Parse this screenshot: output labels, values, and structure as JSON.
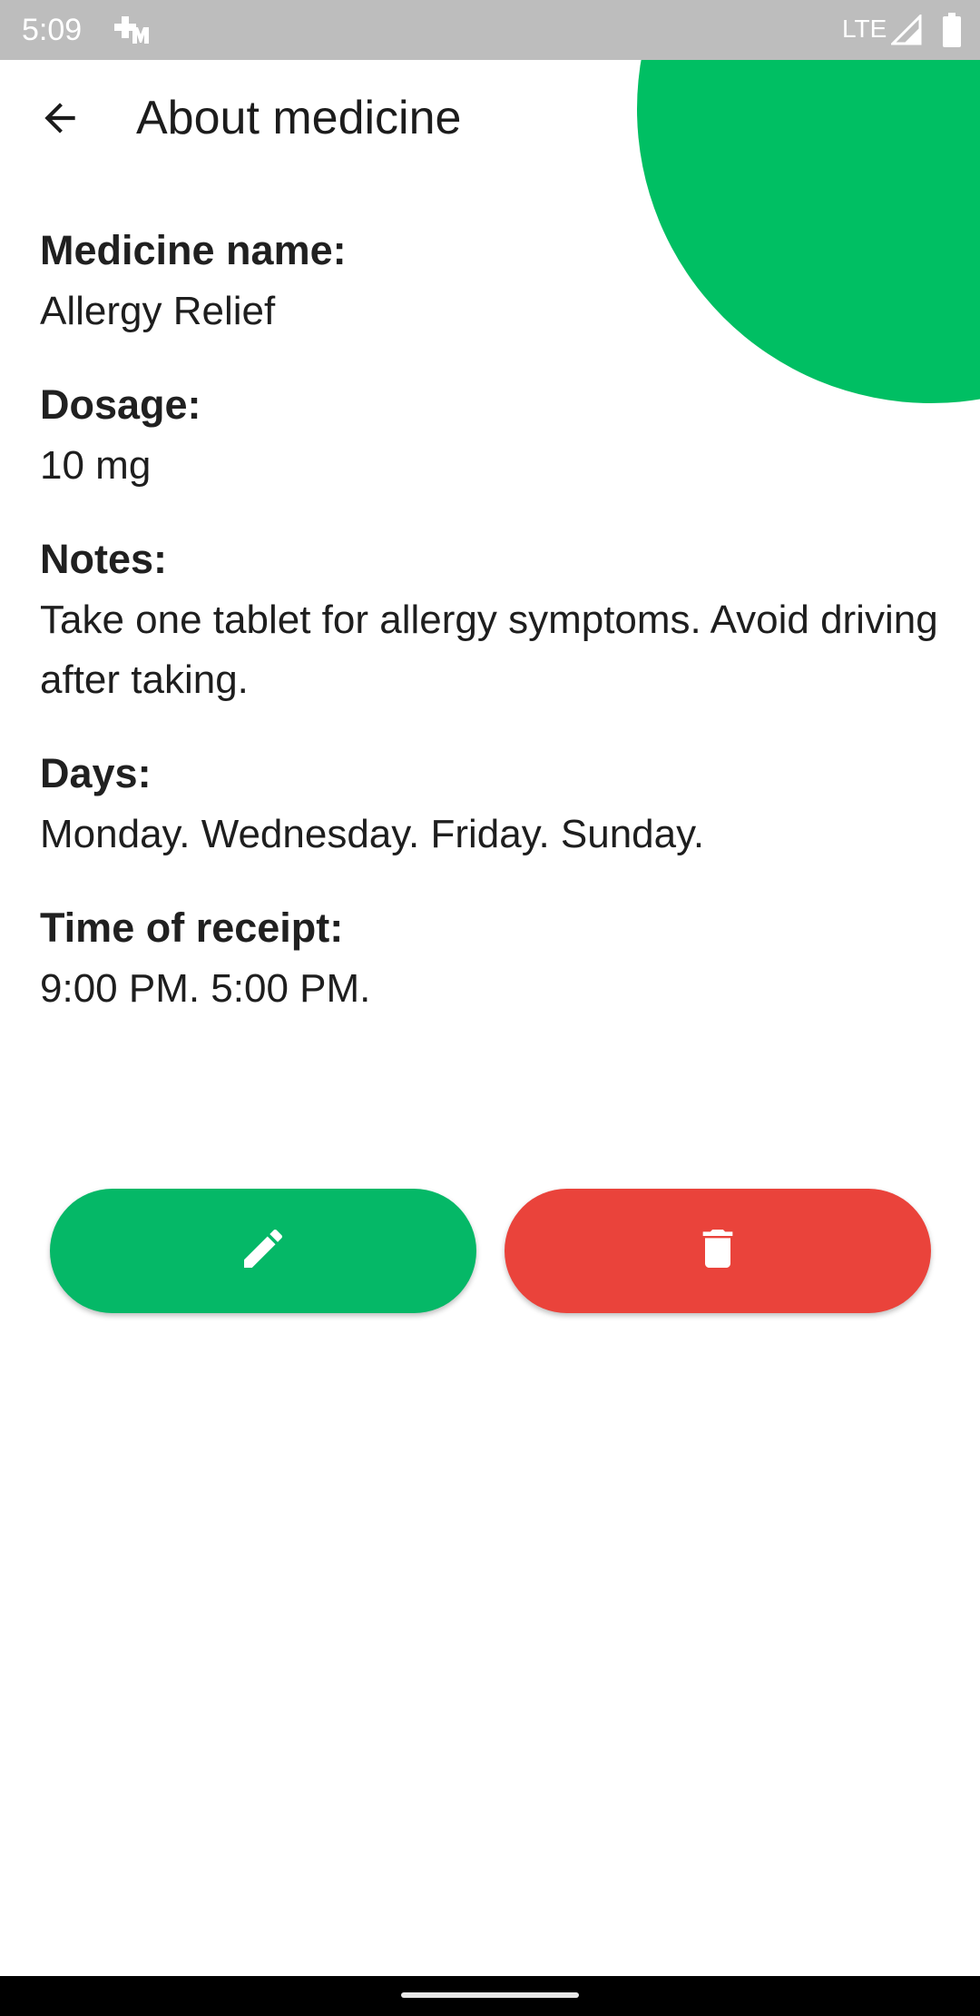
{
  "status_bar": {
    "time": "5:09",
    "network": "LTE",
    "app_icon": "medical-cross-m-icon",
    "signal_icon": "signal-icon",
    "battery_icon": "battery-icon"
  },
  "app_bar": {
    "title": "About medicine",
    "back_icon": "arrow-back-icon"
  },
  "fields": {
    "medicine_name": {
      "label": "Medicine name:",
      "value": "Allergy Relief"
    },
    "dosage": {
      "label": "Dosage:",
      "value": "10 mg"
    },
    "notes": {
      "label": "Notes:",
      "value": "Take one tablet for allergy symptoms. Avoid driving after taking."
    },
    "days": {
      "label": "Days:",
      "value": "Monday. Wednesday. Friday. Sunday."
    },
    "time_of_receipt": {
      "label": "Time of receipt:",
      "value": "9:00 PM. 5:00 PM."
    }
  },
  "actions": {
    "edit_icon": "pencil-icon",
    "delete_icon": "trash-icon"
  },
  "colors": {
    "accent_green": "#00bf63",
    "edit_button": "#05b867",
    "delete_button": "#ea433b",
    "status_bar": "#bdbdbd"
  }
}
